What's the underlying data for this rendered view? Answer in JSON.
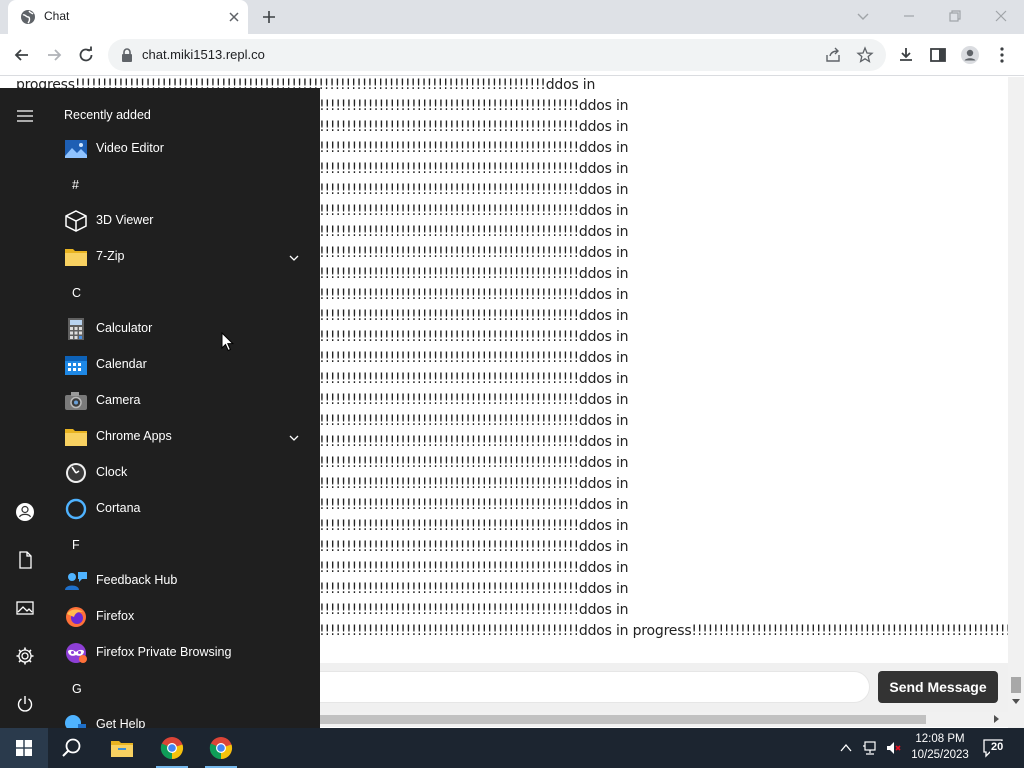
{
  "browser": {
    "tab_title": "Chat",
    "url": "chat.miki1513.repl.co"
  },
  "page": {
    "first_line": "progress!!!!!!!!!!!!!!!!!!!!!!!!!!!!!!!!!!!!!!!!!!!!!!!!!!!!!!!!!!!!!!!!!!!!!!!!!!!!!!!!!!!!!!!ddos in",
    "repeat_line": "!!!!!!!!!!!!!!!!!!!!!!!!!!!!!!!!!!!!!!!!!!!!!!!!!!!!!!!!!!!!!!!!!!!!!!!!!!!!!!!!!!!!!!!!!!!!!!!!!!!!!!!!ddos in",
    "last_line": "!!!!!!!!!!!!!!!!!!!!!!!!!!!!!!!!!!!!!!!!!!!!!!!!!!!!!!!!!!!!!!!!!!!!!!!!!!!!!!!!!!!!!!!!!!!!!!!!!!!!!!!!ddos in progress!!!!!!!!!!!!!!!!!!!!!!!!!!!!!!!!!!!!!!!!!!!!!!!!!!!!!!!!!!!!!!!!!!!!!!!!!!!!!!!!!!!!!!!!!",
    "repeat_count": 25,
    "send_button": "Send Message",
    "chat_input_value": ""
  },
  "start_menu": {
    "recently_added": "Recently added",
    "items": [
      {
        "kind": "app",
        "name": "Video Editor",
        "icon": "video-editor-icon"
      },
      {
        "kind": "letter",
        "name": "#"
      },
      {
        "kind": "app",
        "name": "3D Viewer",
        "icon": "cube-icon"
      },
      {
        "kind": "folder",
        "name": "7-Zip",
        "icon": "folder-icon"
      },
      {
        "kind": "letter",
        "name": "C"
      },
      {
        "kind": "app",
        "name": "Calculator",
        "icon": "calculator-icon"
      },
      {
        "kind": "app",
        "name": "Calendar",
        "icon": "calendar-icon"
      },
      {
        "kind": "app",
        "name": "Camera",
        "icon": "camera-icon"
      },
      {
        "kind": "folder",
        "name": "Chrome Apps",
        "icon": "folder-icon"
      },
      {
        "kind": "app",
        "name": "Clock",
        "icon": "clock-icon"
      },
      {
        "kind": "app",
        "name": "Cortana",
        "icon": "cortana-icon"
      },
      {
        "kind": "letter",
        "name": "F"
      },
      {
        "kind": "app",
        "name": "Feedback Hub",
        "icon": "feedback-hub-icon"
      },
      {
        "kind": "app",
        "name": "Firefox",
        "icon": "firefox-icon"
      },
      {
        "kind": "app",
        "name": "Firefox Private Browsing",
        "icon": "firefox-private-icon"
      },
      {
        "kind": "letter",
        "name": "G"
      },
      {
        "kind": "app",
        "name": "Get Help",
        "icon": "get-help-icon"
      }
    ]
  },
  "taskbar": {
    "time": "12:08 PM",
    "date": "10/25/2023",
    "notification_count": "20"
  },
  "colors": {
    "start_bg": "#1f1f1f",
    "taskbar_bg": "#1c2530",
    "send_button_bg": "#333333"
  }
}
